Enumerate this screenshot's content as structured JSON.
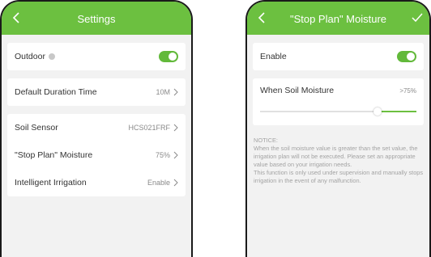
{
  "left": {
    "title": "Settings",
    "outdoor": {
      "label": "Outdoor",
      "enabled": true
    },
    "default_duration": {
      "label": "Default Duration Time",
      "value": "10M"
    },
    "soil_sensor": {
      "label": "Soil Sensor",
      "value": "HCS021FRF"
    },
    "stop_plan_moisture": {
      "label": "\"Stop Plan\" Moisture",
      "value": "75%"
    },
    "intelligent_irrigation": {
      "label": "Intelligent Irrigation",
      "value": "Enable"
    }
  },
  "right": {
    "title": "\"Stop Plan\" Moisture",
    "enable": {
      "label": "Enable",
      "enabled": true
    },
    "soil_moisture": {
      "label": "When Soil Moisture",
      "value": ">75%",
      "level_percent": 75
    },
    "notice": {
      "heading": "NOTICE:",
      "para1": "When the soil moisture value is greater than the set value, the irrigation plan will not be executed. Please set an appropriate value based on your irrigation needs.",
      "para2": "This function is only used under supervision and manually stops irrigation in the event of any malfunction."
    }
  },
  "colors": {
    "accent": "#6cc040",
    "toggle_on": "#62b93a",
    "background": "#f2f2f2"
  },
  "icons": [
    "back-arrow-icon",
    "info-icon",
    "chevron-right-icon",
    "checkmark-icon"
  ]
}
